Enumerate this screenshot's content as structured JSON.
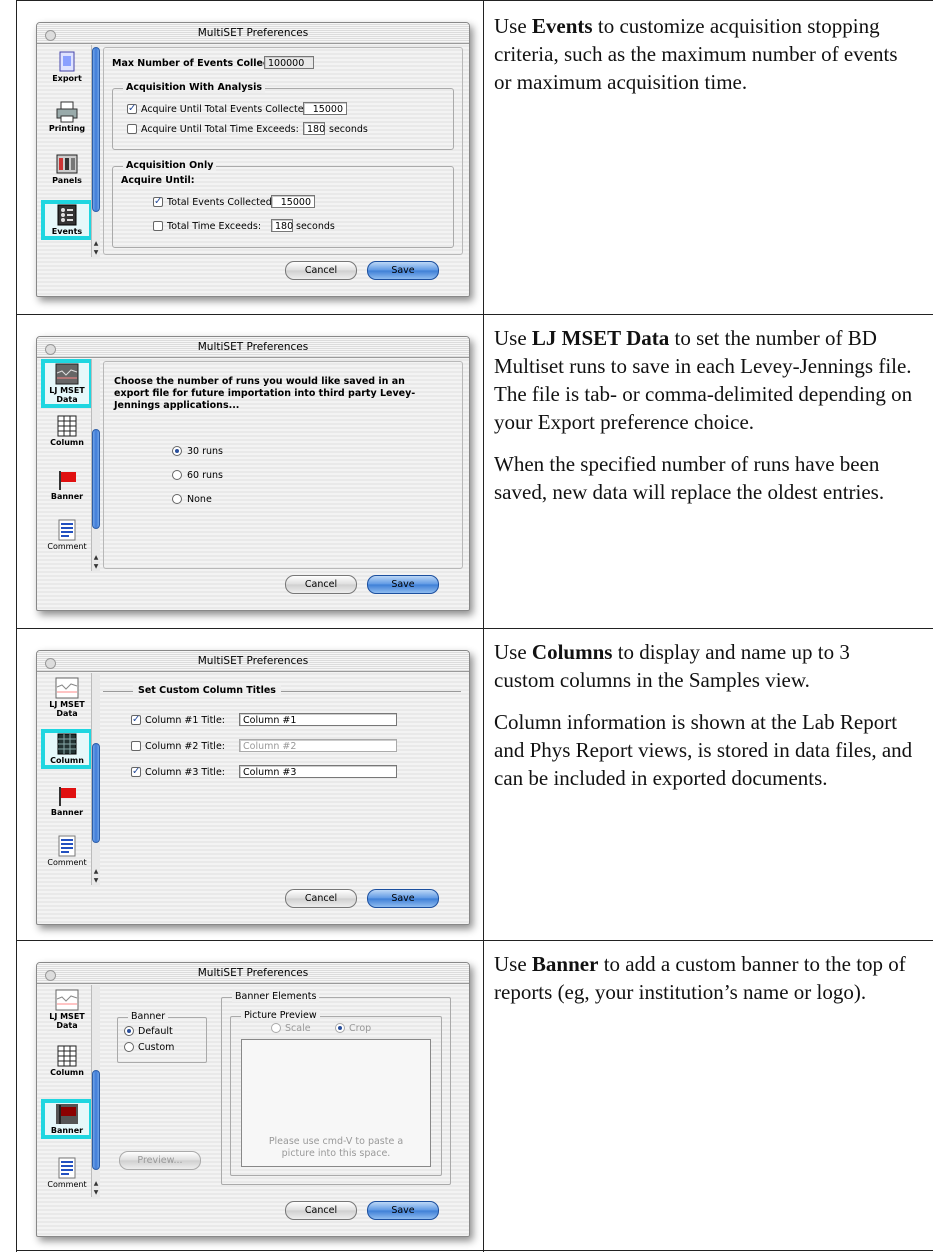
{
  "rows": [
    {
      "dialog": {
        "title": "MultiSET Preferences",
        "sidebar": [
          "Export",
          "Printing",
          "Panels",
          "Events"
        ],
        "selected": "Events",
        "max_events_label": "Max Number of Events Collected:",
        "max_events_value": "100000",
        "group1_title": "Acquisition With Analysis",
        "g1_row1_label": "Acquire Until Total Events Collected:",
        "g1_row1_value": "15000",
        "g1_row2_label": "Acquire Until Total Time Exceeds:",
        "g1_row2_value": "180",
        "g1_row2_unit": "seconds",
        "group2_title": "Acquisition Only",
        "acquire_until": "Acquire Until:",
        "g2_row1_label": "Total Events Collected:",
        "g2_row1_value": "15000",
        "g2_row2_label": "Total Time Exceeds:",
        "g2_row2_value": "180",
        "g2_row2_unit": "seconds",
        "cancel": "Cancel",
        "save": "Save"
      },
      "description": {
        "pre": "Use ",
        "bold": "Events",
        "post": " to customize acquisition stopping criteria, such as the maximum number of events or maximum acquisition time."
      }
    },
    {
      "dialog": {
        "title": "MultiSET Preferences",
        "sidebar": [
          "LJ MSET Data",
          "Column",
          "Banner",
          "Comment"
        ],
        "selected": "LJ MSET Data",
        "prompt": "Choose the number of runs you would like saved in an export file for future importation into third party Levey-Jennings applications...",
        "options": [
          "30 runs",
          "60 runs",
          "None"
        ],
        "selected_option": "30 runs",
        "cancel": "Cancel",
        "save": "Save"
      },
      "description": {
        "pre": "Use ",
        "bold": "LJ MSET Data",
        "post": " to set the number of BD Multiset runs to save in each Levey-Jennings file. The file is tab- or comma-delimited depending on your Export preference choice.",
        "para2": "When the specified number of runs have been saved, new data will replace the oldest entries."
      }
    },
    {
      "dialog": {
        "title": "MultiSET Preferences",
        "sidebar": [
          "LJ MSET Data",
          "Column",
          "Banner",
          "Comment"
        ],
        "selected": "Column",
        "heading": "Set Custom Column Titles",
        "columns": [
          {
            "label": "Column #1 Title:",
            "value": "Column #1",
            "checked": true
          },
          {
            "label": "Column #2 Title:",
            "value": "Column #2",
            "checked": false
          },
          {
            "label": "Column #3 Title:",
            "value": "Column #3",
            "checked": true
          }
        ],
        "cancel": "Cancel",
        "save": "Save"
      },
      "description": {
        "pre": "Use ",
        "bold": "Columns",
        "post": " to display and name up to 3 custom columns in the Samples view.",
        "para2": "Column information is shown at the Lab Report and Phys Report views, is stored in data files, and can be included in exported documents."
      }
    },
    {
      "dialog": {
        "title": "MultiSET Preferences",
        "sidebar": [
          "LJ MSET Data",
          "Column",
          "Banner",
          "Comment"
        ],
        "selected": "Banner",
        "banner_group": "Banner",
        "banner_options": [
          "Default",
          "Custom"
        ],
        "banner_selected": "Default",
        "elements_group": "Banner Elements",
        "preview_group": "Picture Preview",
        "scale": "Scale",
        "crop": "Crop",
        "paste_hint": "Please use cmd-V to paste a picture into this space.",
        "preview_button": "Preview...",
        "cancel": "Cancel",
        "save": "Save"
      },
      "description": {
        "pre": "Use ",
        "bold": "Banner",
        "post": " to add a custom banner to the top of reports (eg, your institution’s name or logo)."
      }
    }
  ],
  "colors": {
    "highlight": "#1fd6e0",
    "button_blue": "#3d7ed6"
  }
}
